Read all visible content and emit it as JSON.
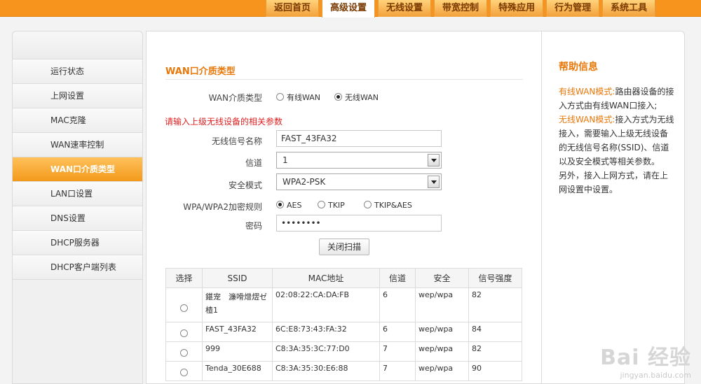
{
  "nav": {
    "tabs": [
      "返回首页",
      "高级设置",
      "无线设置",
      "带宽控制",
      "特殊应用",
      "行为管理",
      "系统工具"
    ],
    "active": 1
  },
  "sidebar": {
    "items": [
      "运行状态",
      "上网设置",
      "MAC克隆",
      "WAN速率控制",
      "WAN口介质类型",
      "LAN口设置",
      "DNS设置",
      "DHCP服务器",
      "DHCP客户端列表"
    ],
    "active": 4
  },
  "main": {
    "title": "WAN口介质类型",
    "media_type": {
      "label": "WAN介质类型",
      "options": [
        "有线WAN",
        "无线WAN"
      ],
      "selected": 1
    },
    "hint": "请输入上级无线设备的相关参数",
    "ssid": {
      "label": "无线信号名称",
      "value": "FAST_43FA32"
    },
    "channel": {
      "label": "信道",
      "value": "1"
    },
    "security": {
      "label": "安全模式",
      "value": "WPA2-PSK"
    },
    "encryption": {
      "label": "WPA/WPA2加密规则",
      "options": [
        "AES",
        "TKIP",
        "TKIP&AES"
      ],
      "selected": 0
    },
    "password": {
      "label": "密码",
      "value": "••••••••"
    },
    "scan_button": "关闭扫描",
    "table": {
      "headers": [
        "选择",
        "SSID",
        "MAC地址",
        "信道",
        "安全",
        "信号强度"
      ],
      "rows": [
        {
          "ssid": "鍖宠　濂嗗熷熤ゼ楂1",
          "mac": "02:08:22:CA:DA:FB",
          "channel": "6",
          "security": "wep/wpa",
          "signal": "82"
        },
        {
          "ssid": "FAST_43FA32",
          "mac": "6C:E8:73:43:FA:32",
          "channel": "6",
          "security": "wep/wpa",
          "signal": "84"
        },
        {
          "ssid": "999",
          "mac": "C8:3A:35:3C:77:D0",
          "channel": "7",
          "security": "wep/wpa",
          "signal": "82"
        },
        {
          "ssid": "Tenda_30E688",
          "mac": "C8:3A:35:30:E6:88",
          "channel": "7",
          "security": "wep/wpa",
          "signal": "90"
        }
      ]
    }
  },
  "help": {
    "title": "帮助信息",
    "p1_key": "有线WAN模式:",
    "p1_text": "路由器设备的接入方式由有线WAN口接入;",
    "p2_key": "无线WAN模式:",
    "p2_text": "接入方式为无线接入，需要输入上级无线设备的无线信号名称(SSID)、信道以及安全模式等相关参数。",
    "p3_text": "另外，接入上网方式，请在上网设置中设置。"
  },
  "watermark": {
    "brand": "Bai 经验",
    "url": "jingyan.baidu.com"
  }
}
